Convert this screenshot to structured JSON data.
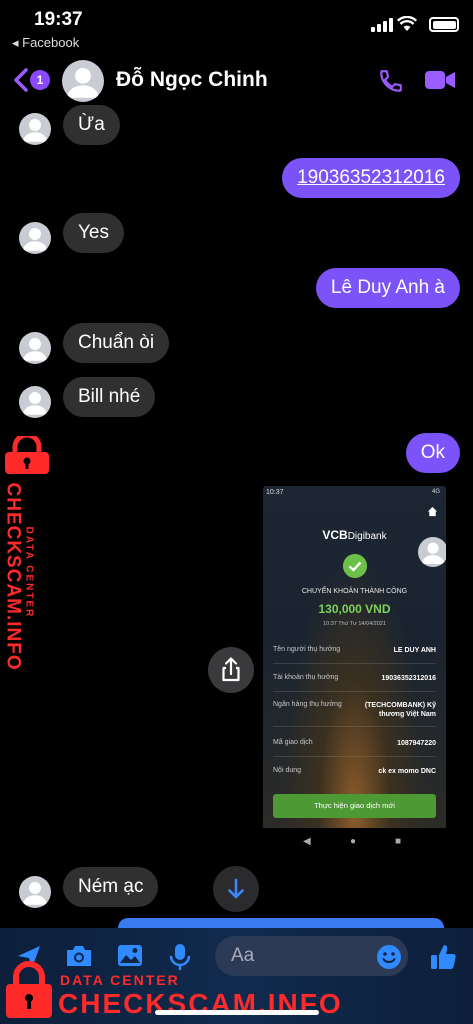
{
  "status_bar": {
    "time": "19:37",
    "back_app": "◂ Facebook"
  },
  "header": {
    "badge": "1",
    "contact_name": "Đỗ Ngọc Chinh"
  },
  "messages": [
    {
      "side": "in",
      "text": "Ừa"
    },
    {
      "side": "out",
      "text": "19036352312016"
    },
    {
      "side": "in",
      "text": "Yes"
    },
    {
      "side": "out",
      "text": "Lê Duy Anh à"
    },
    {
      "side": "in",
      "text": "Chuẩn òi"
    },
    {
      "side": "in",
      "text": "Bill nhé"
    },
    {
      "side": "out",
      "text": "Ok"
    },
    {
      "side": "in",
      "text": "Ném ạc"
    }
  ],
  "receipt": {
    "status_time": "10:37",
    "status_right": "4G",
    "logo_bold": "VCB",
    "logo_rest": "Digibank",
    "success_title": "CHUYỂN KHOẢN THÀNH CÔNG",
    "amount": "130,000 VND",
    "datetime": "10:37 Thứ Tư 14/04/2021",
    "rows": [
      {
        "label": "Tên người thụ hưởng",
        "value": "LE DUY ANH"
      },
      {
        "label": "Tài khoản thụ hưởng",
        "value": "19036352312016"
      },
      {
        "label": "Ngân hàng thụ hưởng",
        "value": "(TECHCOMBANK) Kỹ thương Việt Nam"
      },
      {
        "label": "Mã giao dịch",
        "value": "1087947220"
      },
      {
        "label": "Nội dung",
        "value": "ck ex momo DNC"
      }
    ],
    "cta": "Thực hiện giao dịch mới"
  },
  "composer": {
    "placeholder": "Aa"
  },
  "watermark": {
    "small": "DATA CENTER",
    "big": "CHECKSCAM.INFO"
  },
  "colors": {
    "outgoing": "#7b53f8",
    "incoming": "#303030",
    "accent": "#8a48ff",
    "watermark": "#ff2a2a"
  }
}
